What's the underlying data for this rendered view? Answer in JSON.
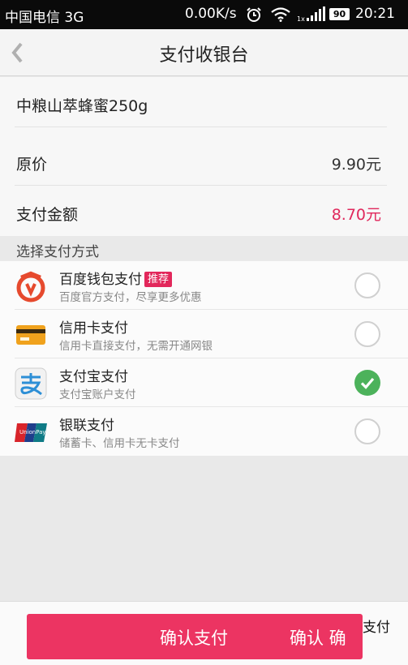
{
  "status_bar": {
    "carrier": "中国电信 3G",
    "net_speed": "0.00K/s",
    "battery": "90",
    "time": "20:21"
  },
  "nav": {
    "title": "支付收银台",
    "back_icon": "chevron-left-icon"
  },
  "order": {
    "product_name": "中粮山萃蜂蜜250g",
    "original_price_label": "原价",
    "original_price_value": "9.90元",
    "pay_amount_label": "支付金额",
    "pay_amount_value": "8.70元"
  },
  "payment_section": {
    "title": "选择支付方式",
    "methods": [
      {
        "name": "百度钱包支付",
        "tag": "推荐",
        "desc": "百度官方支付，尽享更多优惠",
        "icon": "baidu-wallet-icon",
        "selected": false
      },
      {
        "name": "信用卡支付",
        "desc": "信用卡直接支付，无需开通网银",
        "icon": "credit-card-icon",
        "selected": false
      },
      {
        "name": "支付宝支付",
        "desc": "支付宝账户支付",
        "icon": "alipay-icon",
        "selected": true
      },
      {
        "name": "银联支付",
        "desc": "储蓄卡、信用卡无卡支付",
        "icon": "unionpay-icon",
        "selected": false
      }
    ]
  },
  "footer": {
    "confirm_label": "确认支付",
    "confirm_label_overlap": "确认 确",
    "right_label": "支付"
  },
  "colors": {
    "accent_pink": "#ec3462",
    "price_pink": "#e0285c",
    "selected_green": "#4cb25b",
    "status_bar_bg": "#0a0a0a"
  }
}
